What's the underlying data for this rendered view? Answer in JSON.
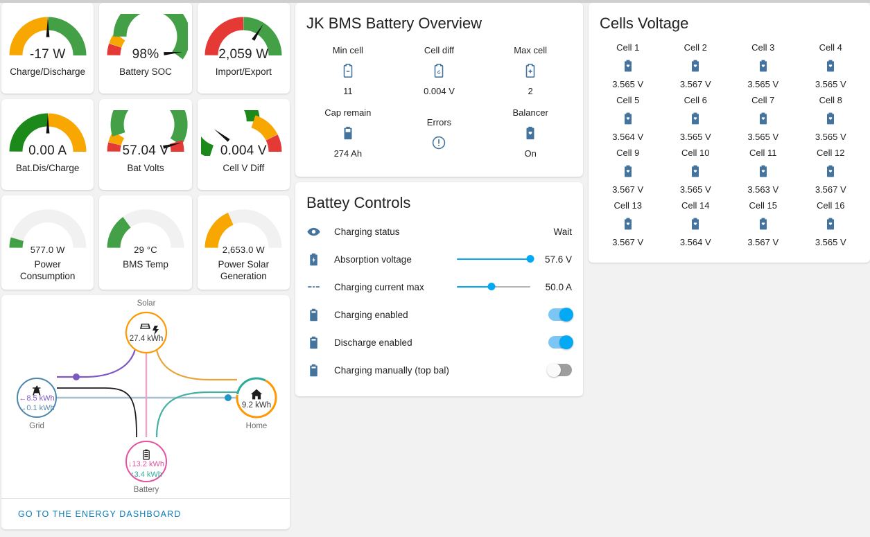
{
  "gauges": [
    {
      "value": "-17 W",
      "label": "Charge/Discharge",
      "type": "needle",
      "needle_pct": 50,
      "segments": [
        {
          "color": "#f7a700",
          "from": 0,
          "to": 50
        },
        {
          "color": "#43a047",
          "from": 50,
          "to": 100
        }
      ]
    },
    {
      "value": "98%",
      "label": "Battery SOC",
      "type": "needle",
      "needle_pct": 97,
      "segments": [
        {
          "color": "#e53935",
          "from": 0,
          "to": 10
        },
        {
          "color": "#f7a700",
          "from": 10,
          "to": 20
        },
        {
          "color": "#43a047",
          "from": 20,
          "to": 100
        }
      ]
    },
    {
      "value": "2,059 W",
      "label": "Import/Export",
      "type": "needle",
      "needle_pct": 68,
      "segments": [
        {
          "color": "#e53935",
          "from": 0,
          "to": 50
        },
        {
          "color": "#43a047",
          "from": 50,
          "to": 100
        }
      ]
    },
    {
      "value": "0.00 A",
      "label": "Bat.Dis/Charge",
      "type": "needle",
      "needle_pct": 50,
      "segments": [
        {
          "color": "#1b8a1b",
          "from": 0,
          "to": 50
        },
        {
          "color": "#f7a700",
          "from": 50,
          "to": 100
        }
      ]
    },
    {
      "value": "57.04 V",
      "label": "Bat Volts",
      "type": "needle",
      "needle_pct": 92,
      "segments": [
        {
          "color": "#e53935",
          "from": 0,
          "to": 8
        },
        {
          "color": "#f7a700",
          "from": 8,
          "to": 18
        },
        {
          "color": "#43a047",
          "from": 18,
          "to": 90
        },
        {
          "color": "#e53935",
          "from": 90,
          "to": 100
        }
      ]
    },
    {
      "value": "0.004 V",
      "label": "Cell V Diff",
      "type": "needle",
      "needle_pct": 21,
      "segments": [
        {
          "color": "#1b8a1b",
          "from": 0,
          "to": 60
        },
        {
          "color": "#f7a700",
          "from": 60,
          "to": 85
        },
        {
          "color": "#e53935",
          "from": 85,
          "to": 100
        }
      ]
    },
    {
      "value": "577.0 W",
      "label": "Power Consumption",
      "type": "severity",
      "fill_pct": 9,
      "fill_color": "#43a047"
    },
    {
      "value": "29 °C",
      "label": "BMS Temp",
      "type": "severity",
      "fill_pct": 30,
      "fill_color": "#43a047"
    },
    {
      "value": "2,653.0 W",
      "label": "Power Solar Generation",
      "type": "severity",
      "fill_pct": 37,
      "fill_color": "#f7a700"
    }
  ],
  "bms": {
    "title": "JK BMS Battery Overview",
    "items": [
      {
        "name": "Min cell",
        "icon": "battery-minus-icon",
        "state": "11"
      },
      {
        "name": "Cell diff",
        "icon": "battery-sync-icon",
        "state": "0.004 V"
      },
      {
        "name": "Max cell",
        "icon": "battery-plus-icon",
        "state": "2"
      },
      {
        "name": "Cap remain",
        "icon": "battery-icon",
        "state": "274 Ah"
      },
      {
        "name": "Errors",
        "icon": "alert-circle-icon",
        "state": ""
      },
      {
        "name": "Balancer",
        "icon": "battery-heart-icon",
        "state": "On"
      }
    ]
  },
  "controls": {
    "title": "Battey Controls",
    "rows": [
      {
        "name": "Charging status",
        "icon": "eye-icon",
        "kind": "text",
        "value": "Wait"
      },
      {
        "name": "Absorption voltage",
        "icon": "battery-charging-icon",
        "kind": "slider",
        "value": "57.6 V",
        "slider_pct": 100
      },
      {
        "name": "Charging current max",
        "icon": "dc-current-icon",
        "kind": "slider",
        "value": "50.0 A",
        "slider_pct": 47
      },
      {
        "name": "Charging enabled",
        "icon": "battery-switch-icon",
        "kind": "toggle",
        "value": "on"
      },
      {
        "name": "Discharge enabled",
        "icon": "battery-switch-icon",
        "kind": "toggle",
        "value": "on"
      },
      {
        "name": "Charging manually (top bal)",
        "icon": "battery-switch-icon",
        "kind": "toggle",
        "value": "off"
      }
    ]
  },
  "cells": {
    "title": "Cells Voltage",
    "icon": "battery-heart-icon",
    "items": [
      {
        "name": "Cell 1",
        "state": "3.565 V"
      },
      {
        "name": "Cell 2",
        "state": "3.567 V"
      },
      {
        "name": "Cell 3",
        "state": "3.565 V"
      },
      {
        "name": "Cell 4",
        "state": "3.565 V"
      },
      {
        "name": "Cell 5",
        "state": "3.564 V"
      },
      {
        "name": "Cell 6",
        "state": "3.565 V"
      },
      {
        "name": "Cell 7",
        "state": "3.565 V"
      },
      {
        "name": "Cell 8",
        "state": "3.565 V"
      },
      {
        "name": "Cell 9",
        "state": "3.567 V"
      },
      {
        "name": "Cell 10",
        "state": "3.565 V"
      },
      {
        "name": "Cell 11",
        "state": "3.563 V"
      },
      {
        "name": "Cell 12",
        "state": "3.567 V"
      },
      {
        "name": "Cell 13",
        "state": "3.567 V"
      },
      {
        "name": "Cell 14",
        "state": "3.564 V"
      },
      {
        "name": "Cell 15",
        "state": "3.567 V"
      },
      {
        "name": "Cell 16",
        "state": "3.565 V"
      }
    ]
  },
  "energy": {
    "solar": {
      "label": "Solar",
      "value": "27.4 kWh",
      "color": "#ff9800"
    },
    "grid": {
      "label": "Grid",
      "in": "8.5 kWh",
      "out": "0.1 kWh",
      "in_arrow": "←",
      "out_arrow": "→",
      "color": "#5486a8"
    },
    "home": {
      "label": "Home",
      "value": "9.2 kWh",
      "solar_color": "#ff9800",
      "battery_color": "#2eab9a"
    },
    "battery": {
      "label": "Battery",
      "in": "13.2 kWh",
      "out": "3.4 kWh",
      "in_arrow": "↓",
      "out_arrow": "↑",
      "color": "#e452a0"
    },
    "link": "GO TO THE ENERGY DASHBOARD"
  }
}
